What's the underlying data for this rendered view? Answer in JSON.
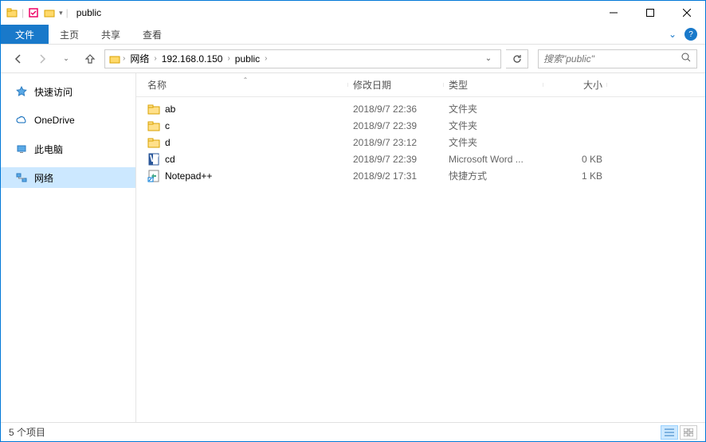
{
  "titlebar": {
    "title": "public"
  },
  "ribbon": {
    "file": "文件",
    "tabs": [
      "主页",
      "共享",
      "查看"
    ]
  },
  "nav": {
    "back": "←",
    "forward": "→",
    "up": "↑"
  },
  "breadcrumb": [
    "网络",
    "192.168.0.150",
    "public"
  ],
  "search": {
    "placeholder": "搜索\"public\""
  },
  "navpane": {
    "quick": "快速访问",
    "onedrive": "OneDrive",
    "thispc": "此电脑",
    "network": "网络"
  },
  "columns": {
    "name": "名称",
    "date": "修改日期",
    "type": "类型",
    "size": "大小"
  },
  "files": [
    {
      "name": "ab",
      "date": "2018/9/7 22:36",
      "type": "文件夹",
      "size": "",
      "icon": "folder"
    },
    {
      "name": "c",
      "date": "2018/9/7 22:39",
      "type": "文件夹",
      "size": "",
      "icon": "folder"
    },
    {
      "name": "d",
      "date": "2018/9/7 23:12",
      "type": "文件夹",
      "size": "",
      "icon": "folder"
    },
    {
      "name": "cd",
      "date": "2018/9/7 22:39",
      "type": "Microsoft Word ...",
      "size": "0 KB",
      "icon": "word"
    },
    {
      "name": "Notepad++",
      "date": "2018/9/2 17:31",
      "type": "快捷方式",
      "size": "1 KB",
      "icon": "shortcut"
    }
  ],
  "statusbar": {
    "count": "5 个项目"
  }
}
